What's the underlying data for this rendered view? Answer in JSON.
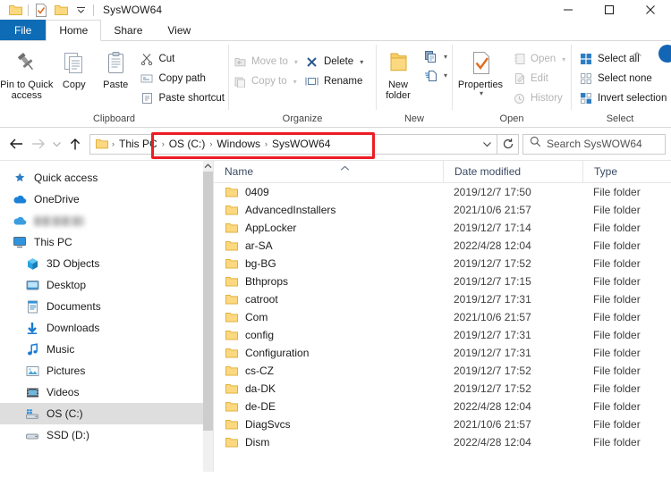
{
  "window": {
    "title": "SysWOW64",
    "quick_access_toolbar": [
      {
        "name": "folder-icon",
        "label": "Explorer menu"
      },
      {
        "name": "properties-icon",
        "label": "Properties"
      },
      {
        "name": "new-folder-icon",
        "label": "New folder"
      },
      {
        "name": "chevron-down-icon",
        "label": "Customize Quick Access Toolbar"
      }
    ],
    "controls": {
      "minimize": "Minimize",
      "maximize": "Maximize",
      "close": "Close"
    }
  },
  "tabs": [
    {
      "label": "File",
      "active": false,
      "style": "file"
    },
    {
      "label": "Home",
      "active": true,
      "style": "normal"
    },
    {
      "label": "Share",
      "active": false,
      "style": "normal"
    },
    {
      "label": "View",
      "active": false,
      "style": "normal"
    }
  ],
  "ribbon": {
    "collapse_label": "Collapse the Ribbon",
    "help_label": "Help",
    "groups": [
      {
        "label": "Clipboard",
        "big": [
          {
            "label": "Pin to Quick\naccess",
            "icon": "pin-icon",
            "disabled": false
          },
          {
            "label": "Copy",
            "icon": "copy-icon",
            "disabled": false
          },
          {
            "label": "Paste",
            "icon": "paste-icon",
            "disabled": false
          }
        ],
        "small": [
          {
            "label": "Cut",
            "icon": "scissors-icon",
            "disabled": false
          },
          {
            "label": "Copy path",
            "icon": "copy-path-icon",
            "disabled": false
          },
          {
            "label": "Paste shortcut",
            "icon": "paste-shortcut-icon",
            "disabled": false
          }
        ]
      },
      {
        "label": "Organize",
        "small_a": [
          {
            "label": "Move to",
            "icon": "move-to-icon",
            "disabled": true,
            "caret": true
          },
          {
            "label": "Copy to",
            "icon": "copy-to-icon",
            "disabled": true,
            "caret": true
          }
        ],
        "small_b": [
          {
            "label": "Delete",
            "icon": "delete-icon",
            "disabled": false,
            "caret": true
          },
          {
            "label": "Rename",
            "icon": "rename-icon",
            "disabled": false,
            "caret": false
          }
        ]
      },
      {
        "label": "New",
        "big": [
          {
            "label": "New\nfolder",
            "icon": "new-folder-icon",
            "disabled": false
          }
        ],
        "split": [
          {
            "label": "New item",
            "icon": "new-item-icon"
          },
          {
            "label": "Easy access",
            "icon": "easy-access-icon"
          }
        ]
      },
      {
        "label": "Open",
        "big": [
          {
            "label": "Properties",
            "icon": "properties-icon",
            "disabled": false,
            "caret": true
          }
        ],
        "small": [
          {
            "label": "Open",
            "icon": "open-icon",
            "disabled": true,
            "caret": true
          },
          {
            "label": "Edit",
            "icon": "edit-icon",
            "disabled": true,
            "caret": false
          },
          {
            "label": "History",
            "icon": "history-icon",
            "disabled": true,
            "caret": false
          }
        ]
      },
      {
        "label": "Select",
        "small": [
          {
            "label": "Select all",
            "icon": "select-all-icon",
            "disabled": false
          },
          {
            "label": "Select none",
            "icon": "select-none-icon",
            "disabled": false
          },
          {
            "label": "Invert selection",
            "icon": "invert-selection-icon",
            "disabled": false
          }
        ]
      }
    ]
  },
  "addressbar": {
    "back_label": "Back",
    "forward_label": "Forward",
    "recent_label": "Recent locations",
    "up_label": "Up to This PC",
    "breadcrumbs": [
      "This PC",
      "OS (C:)",
      "Windows",
      "SysWOW64"
    ],
    "separator": "›",
    "dropdown_label": "Previous locations",
    "refresh_label": "Refresh",
    "search_placeholder": "Search SysWOW64",
    "highlight_color": "#ec1c24"
  },
  "sidebar": {
    "items": [
      {
        "label": "Quick access",
        "icon": "star-pin-icon",
        "indent": false,
        "selected": false
      },
      {
        "label": "OneDrive",
        "icon": "onedrive-cloud-icon",
        "indent": false,
        "selected": false
      },
      {
        "label": "",
        "icon": "onedrive-cloud-icon",
        "indent": false,
        "selected": false,
        "redacted": true
      },
      {
        "label": "This PC",
        "icon": "monitor-icon",
        "indent": false,
        "selected": false
      },
      {
        "label": "3D Objects",
        "icon": "3d-objects-icon",
        "indent": true,
        "selected": false
      },
      {
        "label": "Desktop",
        "icon": "desktop-icon",
        "indent": true,
        "selected": false
      },
      {
        "label": "Documents",
        "icon": "documents-icon",
        "indent": true,
        "selected": false
      },
      {
        "label": "Downloads",
        "icon": "downloads-icon",
        "indent": true,
        "selected": false
      },
      {
        "label": "Music",
        "icon": "music-icon",
        "indent": true,
        "selected": false
      },
      {
        "label": "Pictures",
        "icon": "pictures-icon",
        "indent": true,
        "selected": false
      },
      {
        "label": "Videos",
        "icon": "videos-icon",
        "indent": true,
        "selected": false
      },
      {
        "label": "OS (C:)",
        "icon": "local-disk-icon",
        "indent": true,
        "selected": true
      },
      {
        "label": "SSD (D:)",
        "icon": "local-disk-icon",
        "indent": true,
        "selected": false
      }
    ]
  },
  "filelist": {
    "columns": [
      "Name",
      "Date modified",
      "Type"
    ],
    "sort_column": "Name",
    "sort_direction": "ascending",
    "rows": [
      {
        "name": "0409",
        "date": "2019/12/7 17:50",
        "type": "File folder"
      },
      {
        "name": "AdvancedInstallers",
        "date": "2021/10/6 21:57",
        "type": "File folder"
      },
      {
        "name": "AppLocker",
        "date": "2019/12/7 17:14",
        "type": "File folder"
      },
      {
        "name": "ar-SA",
        "date": "2022/4/28 12:04",
        "type": "File folder"
      },
      {
        "name": "bg-BG",
        "date": "2019/12/7 17:52",
        "type": "File folder"
      },
      {
        "name": "Bthprops",
        "date": "2019/12/7 17:15",
        "type": "File folder"
      },
      {
        "name": "catroot",
        "date": "2019/12/7 17:31",
        "type": "File folder"
      },
      {
        "name": "Com",
        "date": "2021/10/6 21:57",
        "type": "File folder"
      },
      {
        "name": "config",
        "date": "2019/12/7 17:31",
        "type": "File folder"
      },
      {
        "name": "Configuration",
        "date": "2019/12/7 17:31",
        "type": "File folder"
      },
      {
        "name": "cs-CZ",
        "date": "2019/12/7 17:52",
        "type": "File folder"
      },
      {
        "name": "da-DK",
        "date": "2019/12/7 17:52",
        "type": "File folder"
      },
      {
        "name": "de-DE",
        "date": "2022/4/28 12:04",
        "type": "File folder"
      },
      {
        "name": "DiagSvcs",
        "date": "2021/10/6 21:57",
        "type": "File folder"
      },
      {
        "name": "Dism",
        "date": "2022/4/28 12:04",
        "type": "File folder"
      }
    ]
  }
}
